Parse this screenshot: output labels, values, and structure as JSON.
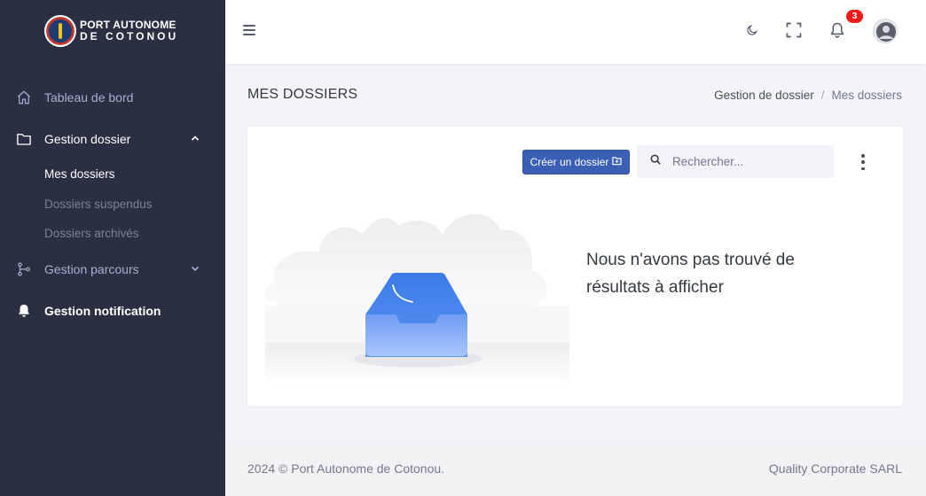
{
  "logo": {
    "line1": "PORT AUTONOME",
    "line2": "DE COTONOU"
  },
  "sidebar": {
    "items": [
      {
        "label": "Tableau de bord",
        "icon": "home-icon"
      },
      {
        "label": "Gestion dossier",
        "icon": "folder-icon",
        "expanded": true,
        "subitems": [
          {
            "label": "Mes dossiers",
            "active": true
          },
          {
            "label": "Dossiers suspendus"
          },
          {
            "label": "Dossiers archivés"
          }
        ]
      },
      {
        "label": "Gestion parcours",
        "icon": "route-icon",
        "expanded": false
      },
      {
        "label": "Gestion notification",
        "icon": "bell-icon"
      }
    ]
  },
  "topbar": {
    "notification_count": "3",
    "icons": [
      "menu-icon",
      "moon-icon",
      "fullscreen-icon",
      "bell-icon",
      "avatar"
    ]
  },
  "page": {
    "title": "MES DOSSIERS",
    "breadcrumb": [
      "Gestion de dossier",
      "Mes dossiers"
    ]
  },
  "toolbar": {
    "create_label": "Créer un dossier",
    "search_placeholder": "Rechercher..."
  },
  "empty_state": {
    "message": "Nous n'avons pas trouvé de résultats à afficher"
  },
  "footer": {
    "left": "2024 © Port Autonome de Cotonou.",
    "right": "Quality Corporate SARL"
  },
  "colors": {
    "sidebar_bg": "#2a3042",
    "primary_button": "#3a5fb5",
    "badge": "#f41b1b",
    "page_bg": "#f3f3f9"
  }
}
